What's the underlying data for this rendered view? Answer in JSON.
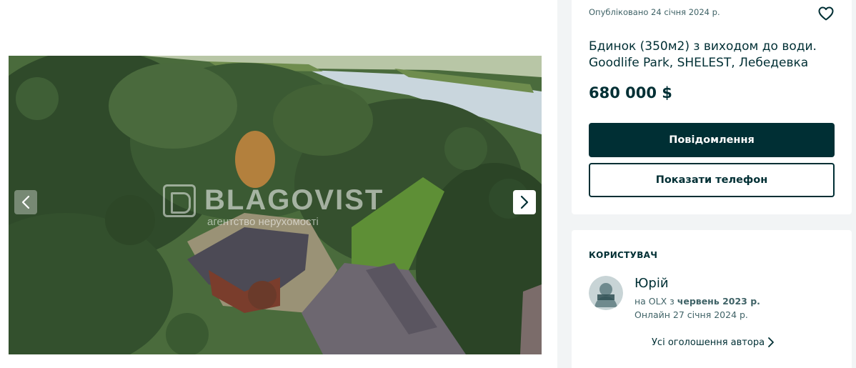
{
  "listing": {
    "posted": "Опубліковано 24 січня 2024 р.",
    "title": "Бдинок (350м2) з виходом до води. Goodlife Park, SHELEST, Лебедевка",
    "price": "680 000 $",
    "message_button": "Повідомлення",
    "phone_button": "Показати телефон",
    "favorite_icon": "heart-outline-icon"
  },
  "gallery": {
    "watermark_brand": "BLAGOVIST",
    "watermark_tagline": "агентство нерухомості",
    "prev_icon": "chevron-left-icon",
    "next_icon": "chevron-right-icon"
  },
  "user": {
    "heading": "КОРИСТУВАЧ",
    "name": "Юрій",
    "since_prefix": "на OLX з",
    "since_value": "червень 2023 р.",
    "online": "Онлайн 27 січня 2024 р.",
    "all_ads_link": "Усі оголошення автора",
    "avatar_icon": "user-avatar-icon"
  },
  "colors": {
    "primary": "#002f34",
    "muted_text": "#406367",
    "background": "#f2f4f5"
  }
}
